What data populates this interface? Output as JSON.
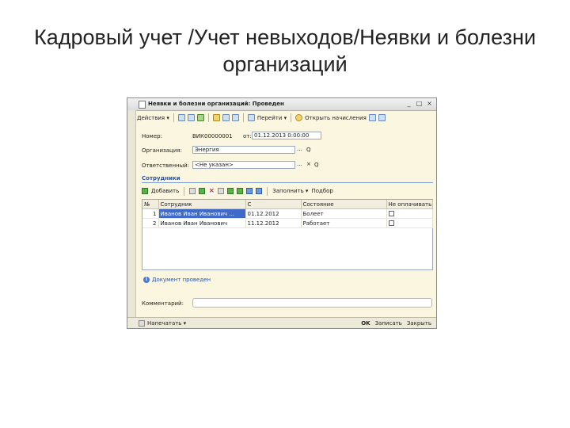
{
  "slide": {
    "title_line1": "Кадровый учет /Учет невыходов/Неявки и болезни",
    "title_line2": "организаций"
  },
  "window": {
    "title": "Неявки и болезни организаций: Проведен",
    "btn_minimize": "_",
    "btn_maximize": "□",
    "btn_close": "×"
  },
  "toolbar": {
    "actions": "Действия ▾",
    "goto": "Перейти ▾",
    "open_charges": "Открыть начисления",
    "help": "?"
  },
  "form": {
    "number_label": "Номер:",
    "number_value": "ВИК00000001",
    "date_label": "от:",
    "date_value": "01.12.2013 0:00:00",
    "org_label": "Организация:",
    "org_value": "Энергия",
    "resp_label": "Ответственный:",
    "resp_value": "<Не указан>",
    "select_btn": "...",
    "search_btn": "Q",
    "clear_btn": "×"
  },
  "section": {
    "title": "Сотрудники"
  },
  "grid_toolbar": {
    "add": "Добавить",
    "fill": "Заполнить ▾",
    "pick": "Подбор"
  },
  "table": {
    "headers": [
      "№",
      "Сотрудник",
      "С",
      "Состояние",
      "Не оплачивать"
    ],
    "rows": [
      {
        "n": "1",
        "employee": "Иванов Иван Иванович ...",
        "date": "01.12.2012",
        "state": "Болеет"
      },
      {
        "n": "2",
        "employee": "Иванов Иван Иванович",
        "date": "11.12.2012",
        "state": "Работает"
      }
    ]
  },
  "status": {
    "info_glyph": "i",
    "text": "Документ проведен"
  },
  "comment": {
    "label": "Комментарий:"
  },
  "bottom": {
    "print": "Напечатать ▾",
    "ok": "OK",
    "save": "Записать",
    "close": "Закрыть"
  }
}
